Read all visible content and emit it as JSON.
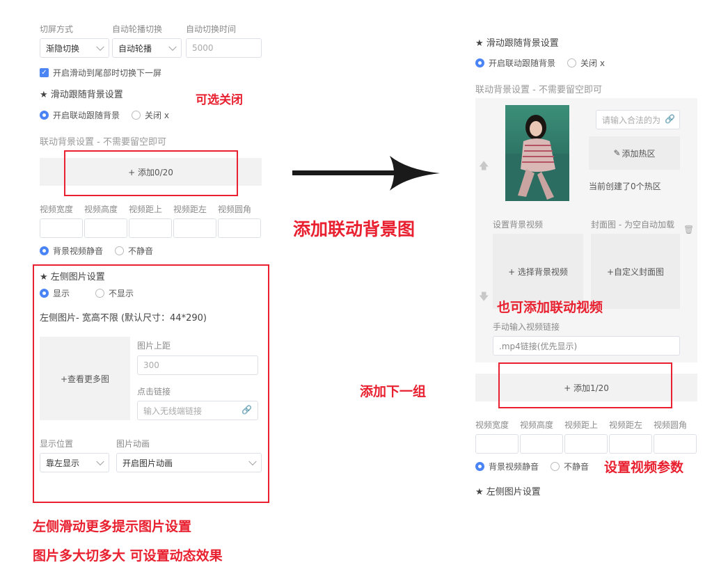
{
  "left": {
    "switch_labels": [
      "切屏方式",
      "自动轮播切换",
      "自动切换时间"
    ],
    "switch_mode": "渐隐切换",
    "carousel_mode": "自动轮播",
    "switch_time_placeholder": "5000",
    "tail_switch_label": "开启滑动到尾部时切换下一屏",
    "scroll_bg_heading": "★ 滑动跟随背景设置",
    "scroll_bg_on": "开启联动跟随背景",
    "scroll_bg_off": "关闭 x",
    "linked_bg_label": "联动背景设置 - 不需要留空即可",
    "add_label": "+ 添加0/20",
    "video_cols": [
      "视频宽度",
      "视频高度",
      "视频距上",
      "视频距左",
      "视频圆角"
    ],
    "mute_on": "背景视频静音",
    "mute_off": "不静音",
    "left_img_heading": "★ 左侧图片设置",
    "show_on": "显示",
    "show_off": "不显示",
    "left_img_desc": "左侧图片- 宽高不限 (默认尺寸：44*290)",
    "more_img": "+查看更多图",
    "img_top_label": "图片上距",
    "img_top_value": "300",
    "click_link_label": "点击链接",
    "click_link_placeholder": "输入无线端链接",
    "position_label": "显示位置",
    "position_value": "靠左显示",
    "anim_label": "图片动画",
    "anim_value": "开启图片动画"
  },
  "right": {
    "scroll_bg_heading": "★ 滑动跟随背景设置",
    "scroll_bg_on": "开启联动跟随背景",
    "scroll_bg_off": "关闭 x",
    "linked_bg_label": "联动背景设置 - 不需要留空即可",
    "link_placeholder": "请输入合法的为",
    "add_hotspot": "添加热区",
    "hotspot_count": "当前创建了0个热区",
    "bg_video_label": "设置背景视频",
    "cover_label": "封面图 - 为空自动加载",
    "choose_video": "+ 选择背景视频",
    "custom_cover": "+自定义封面图",
    "manual_video_label": "手动输入视频链接",
    "mp4_placeholder": ".mp4链接(优先显示)",
    "add_label": "+ 添加1/20",
    "video_cols": [
      "视频宽度",
      "视频高度",
      "视频距上",
      "视频距左",
      "视频圆角"
    ],
    "mute_on": "背景视频静音",
    "mute_off": "不静音",
    "left_img_heading": "★ 左侧图片设置"
  },
  "annotations": {
    "optional_close": "可选关闭",
    "add_linked_bg": "添加联动背景图",
    "add_linked_video": "也可添加联动视频",
    "add_next_group": "添加下一组",
    "set_video_params": "设置视频参数",
    "left_hint_1": "左侧滑动更多提示图片设置",
    "left_hint_2": "图片多大切多大 可设置动态效果"
  },
  "colors": {
    "accent": "#4a84f5",
    "annotation_red": "#e8202f"
  }
}
